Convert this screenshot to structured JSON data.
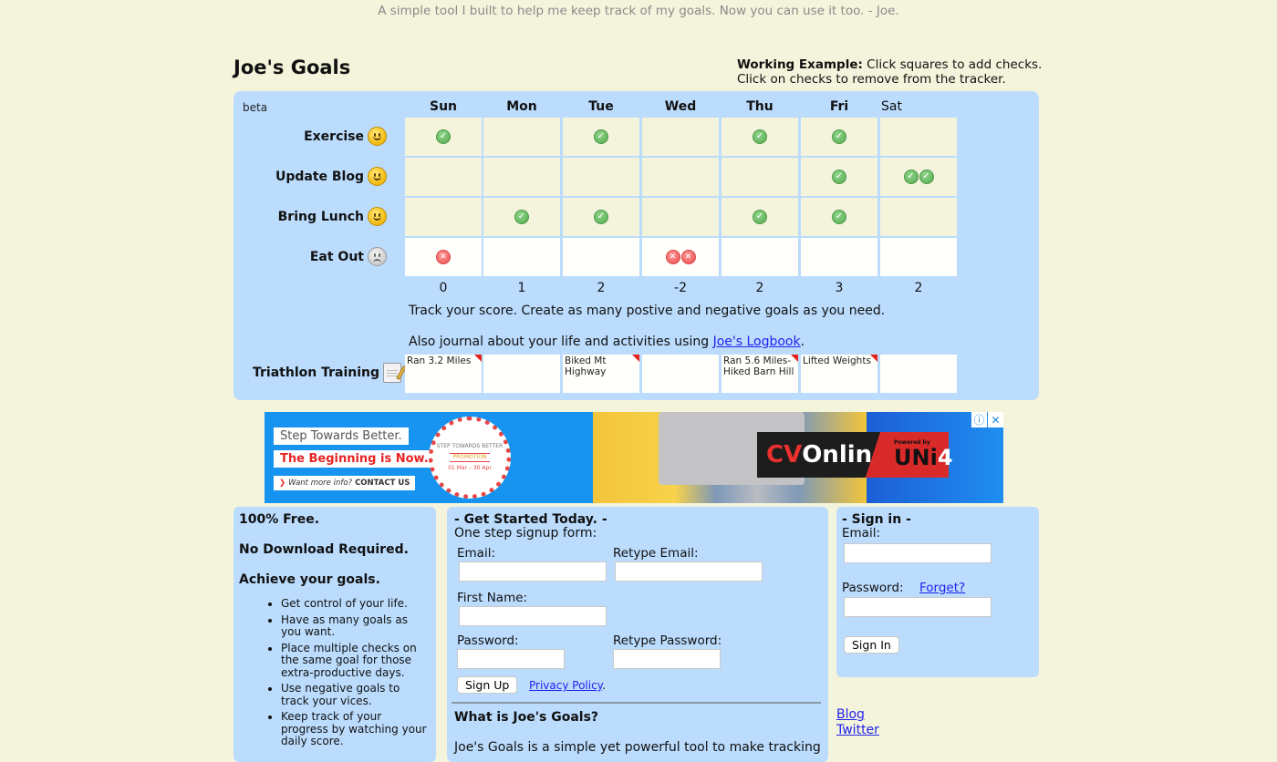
{
  "tagline": "A simple tool I built to help me keep track of my goals. Now you can use it too. - Joe.",
  "site_title": "Joe's Goals",
  "example_note": {
    "bold": "Working Example:",
    "line1": " Click squares to add checks.",
    "line2": "Click on checks to remove from the tracker."
  },
  "tracker": {
    "beta_label": "beta",
    "days": [
      "Sun",
      "Mon",
      "Tue",
      "Wed",
      "Thu",
      "Fri",
      "Sat"
    ],
    "today": "Sat",
    "goals": [
      {
        "name": "Exercise",
        "type": "positive",
        "icon": "smiley-icon",
        "marks": [
          1,
          0,
          1,
          0,
          1,
          1,
          0
        ]
      },
      {
        "name": "Update Blog",
        "type": "positive",
        "icon": "smiley-icon",
        "marks": [
          0,
          0,
          0,
          0,
          0,
          1,
          2
        ]
      },
      {
        "name": "Bring Lunch",
        "type": "positive",
        "icon": "smiley-icon",
        "marks": [
          0,
          1,
          1,
          0,
          1,
          1,
          0
        ]
      },
      {
        "name": "Eat Out",
        "type": "negative",
        "icon": "frowny-icon",
        "marks": [
          1,
          0,
          0,
          2,
          0,
          0,
          0
        ]
      }
    ],
    "scores": [
      "0",
      "1",
      "2",
      "-2",
      "2",
      "3",
      "2"
    ],
    "info1": "Track your score. Create as many postive and negative goals as you need.",
    "info2_prefix": "Also journal about your life and activities using ",
    "info2_link": "Joe's Logbook",
    "info2_suffix": ".",
    "logbook": {
      "name": "Triathlon Training",
      "icon": "notepad-icon",
      "entries": [
        "Ran 3.2 Miles",
        "",
        "Biked Mt Highway",
        "",
        "Ran 5.6 Miles- Hiked Barn Hill",
        "Lifted Weights",
        ""
      ]
    }
  },
  "ad": {
    "line1": "Step Towards Better.",
    "line2": "The Beginning is Now.",
    "line3_prefix": "Want more info?",
    "line3_cta": "CONTACT US",
    "seal_top": "STEP TOWARDS BETTER",
    "seal_mid": "PROMOTION",
    "seal_bottom": "01 Mar  – 30 Apr",
    "brand_cv": "CV",
    "brand_rest": "Online",
    "powered_by": "Powered by",
    "uni": "UNi",
    "uni4": "4",
    "info_icon": "ⓘ",
    "close_icon": "✕"
  },
  "features": {
    "headline1": "100% Free.",
    "headline2": "No Download Required.",
    "headline3": "Achieve your goals.",
    "bullets": [
      "Get control of your life.",
      "Have as many goals as you want.",
      "Place multiple checks on the same goal for those extra-productive days.",
      "Use negative goals to track your vices.",
      "Keep track of your progress by watching your daily score."
    ]
  },
  "signup": {
    "title": "- Get Started Today. -",
    "subtitle": "One step signup form:",
    "email_label": "Email:",
    "retype_email_label": "Retype Email:",
    "first_name_label": "First Name:",
    "password_label": "Password:",
    "retype_password_label": "Retype Password:",
    "email_value": "",
    "retype_email_value": "",
    "first_name_value": "",
    "password_value": "",
    "retype_password_value": "",
    "signup_button": "Sign Up",
    "privacy_link": "Privacy Policy",
    "privacy_suffix": ".",
    "what_title": "What is Joe's Goals?",
    "what_desc": "Joe's Goals is a simple yet powerful tool to make tracking"
  },
  "signin": {
    "title": "- Sign in -",
    "email_label": "Email:",
    "password_label": "Password:",
    "forget_link": "Forget?",
    "email_value": "",
    "password_value": "",
    "signin_button": "Sign In"
  },
  "footer": {
    "blog_link": "Blog",
    "twitter_link": "Twitter"
  }
}
